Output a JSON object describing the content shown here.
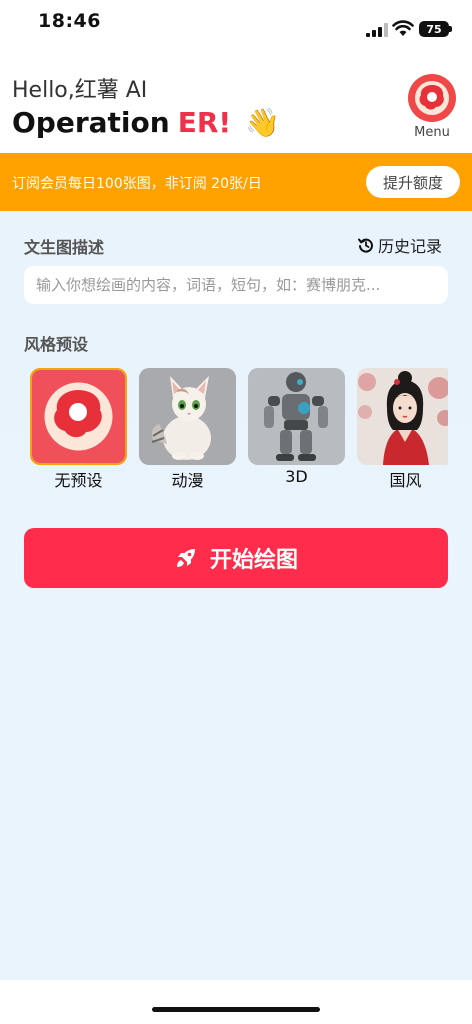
{
  "status": {
    "time": "18:46",
    "battery": "75"
  },
  "header": {
    "greeting": "Hello,红薯 AI",
    "title_main": "Operation",
    "title_accent": "ER!",
    "title_emoji": "👋",
    "menu_label": "Menu"
  },
  "banner": {
    "text": "订阅会员每日100张图，非订阅 20张/日",
    "upgrade_label": "提升额度"
  },
  "prompt": {
    "section_title": "文生图描述",
    "history_label": "历史记录",
    "placeholder": "输入你想绘画的内容，词语，短句，如：赛博朋克..."
  },
  "styles": {
    "section_title": "风格预设",
    "items": [
      {
        "label": "无预设",
        "icon": "app-logo",
        "selected": true
      },
      {
        "label": "动漫",
        "icon": "anime-cat-image",
        "selected": false
      },
      {
        "label": "3D",
        "icon": "3d-robot-image",
        "selected": false
      },
      {
        "label": "国风",
        "icon": "chinese-style-girl-image",
        "selected": false
      }
    ]
  },
  "start": {
    "label": "开始绘图",
    "icon": "rocket-icon"
  },
  "colors": {
    "accent": "#ff2d4b",
    "banner": "#ffa200",
    "selected_border": "#f5a40a"
  }
}
